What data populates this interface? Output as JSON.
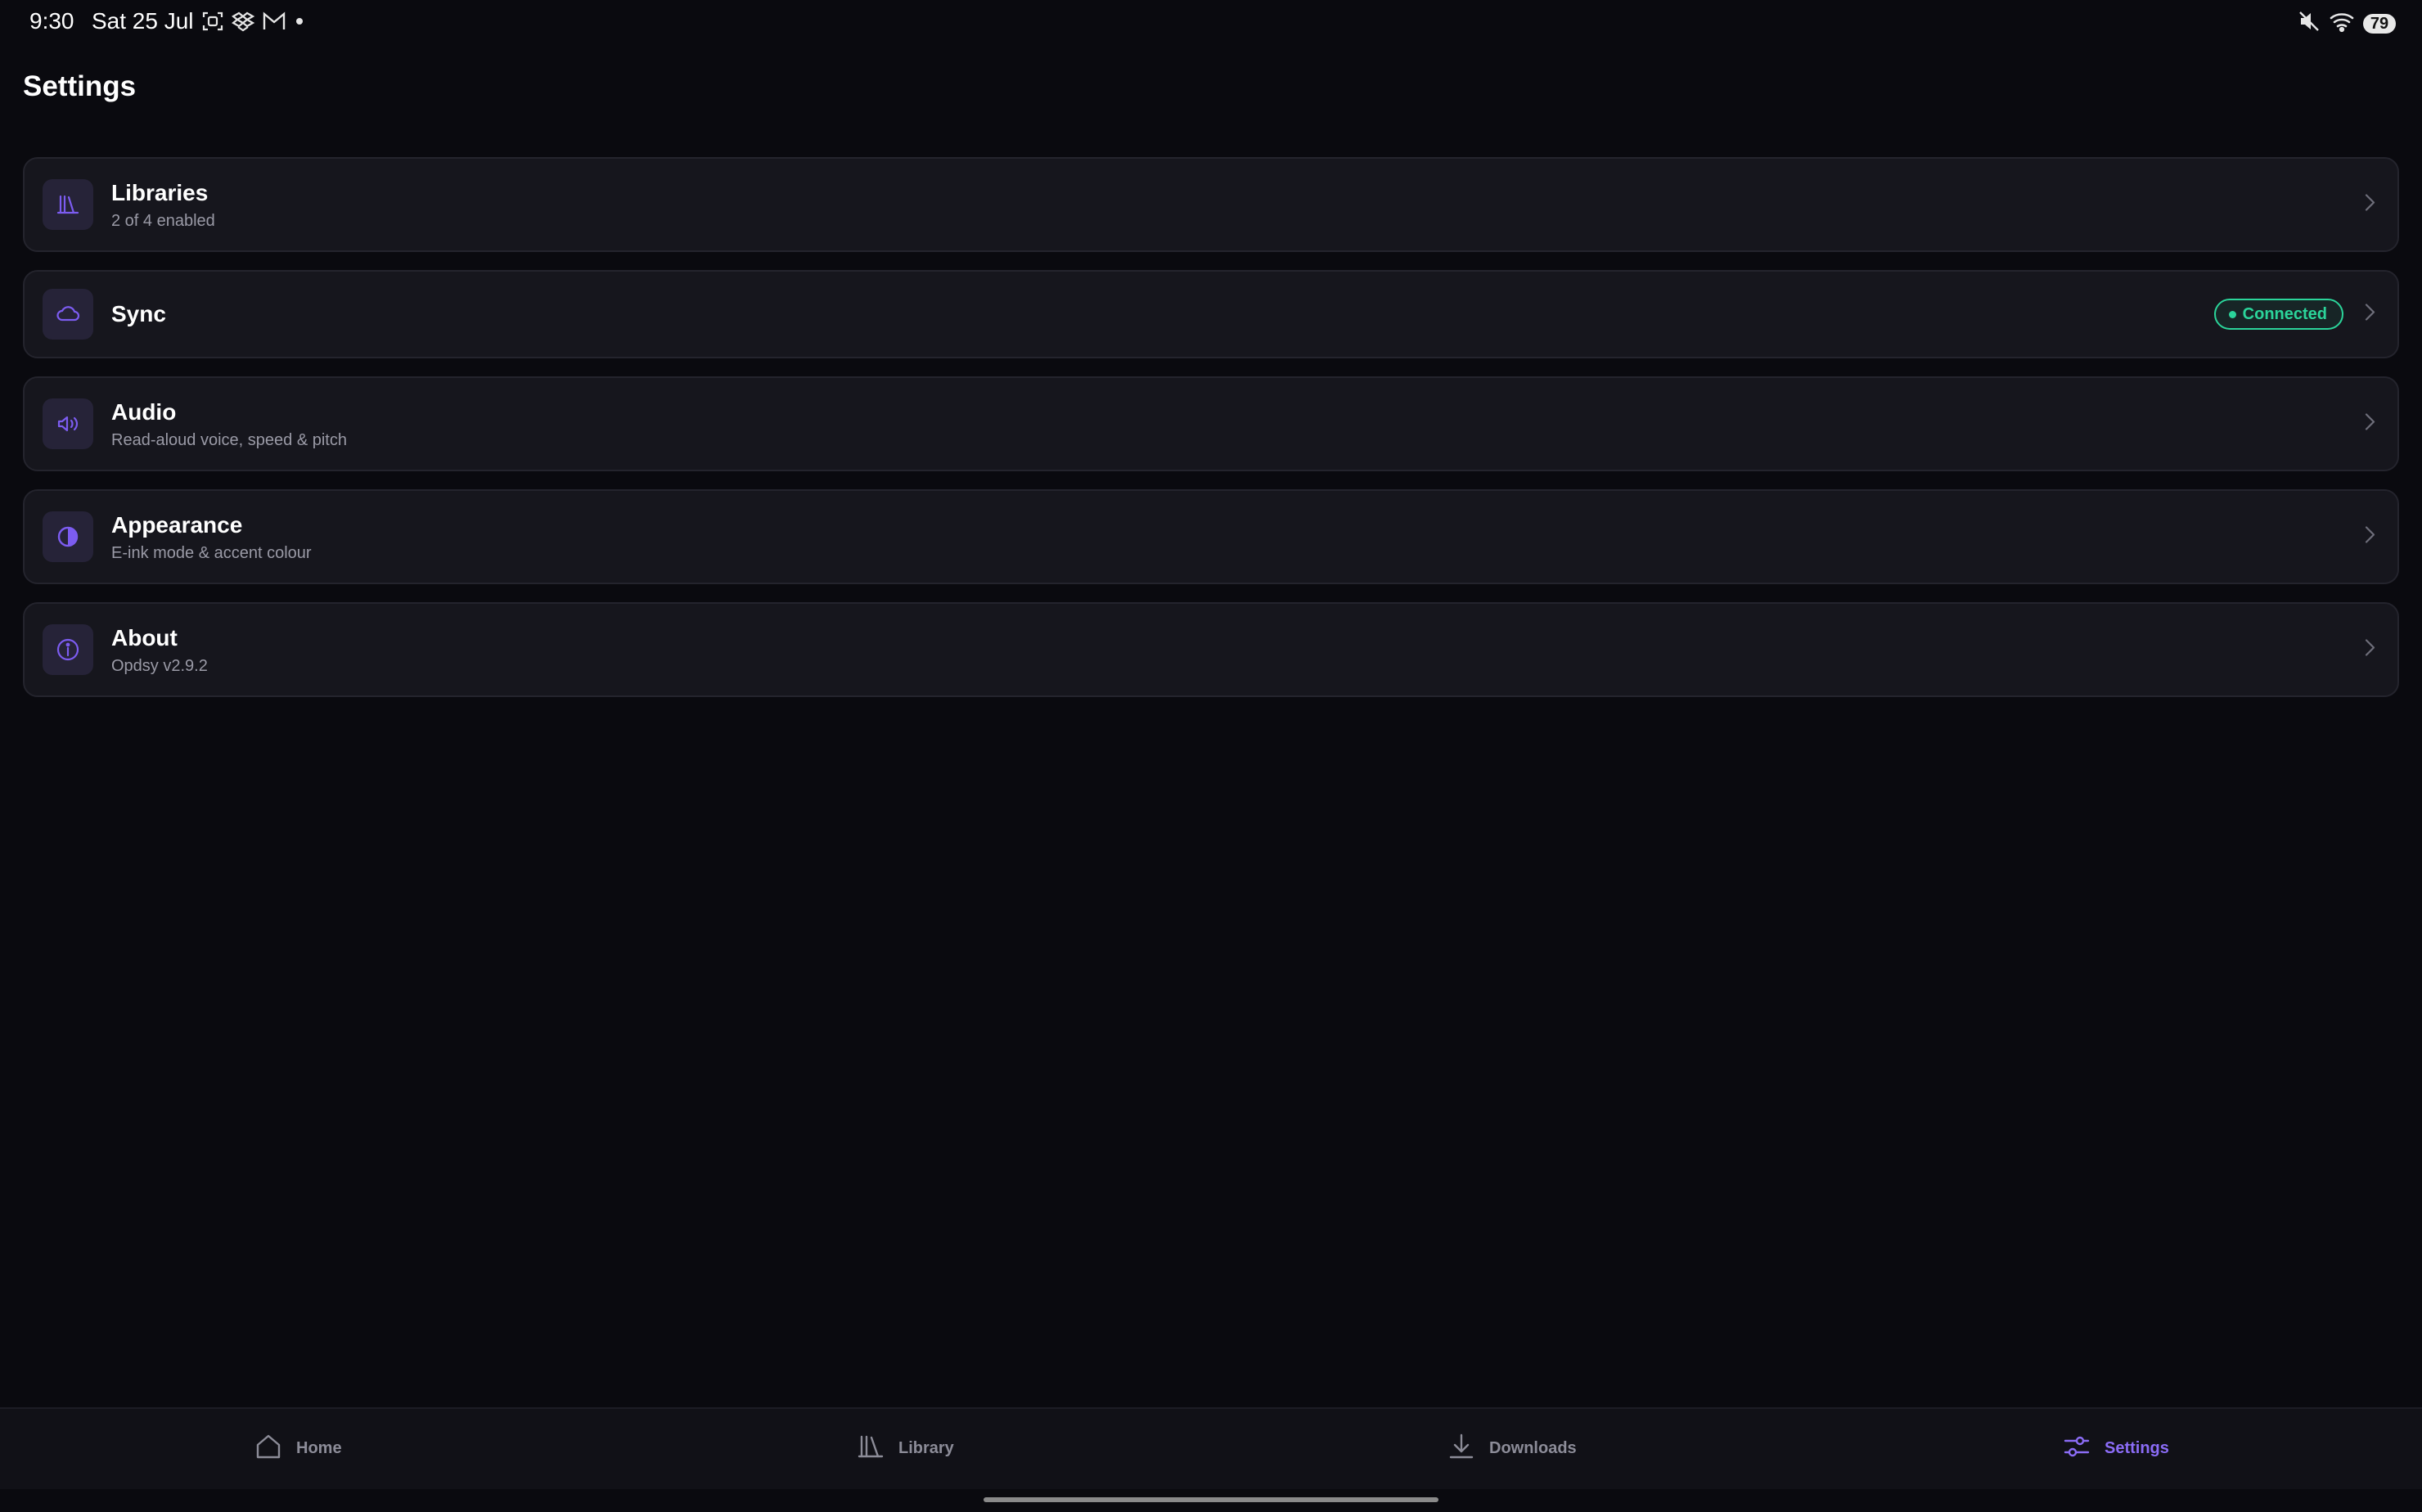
{
  "status_bar": {
    "time": "9:30",
    "date": "Sat 25 Jul",
    "left_icons": [
      "screenshot-icon",
      "dropbox-icon",
      "gmail-icon",
      "dot-icon"
    ],
    "right_icons": [
      "mute-icon",
      "wifi-icon"
    ],
    "battery": "79"
  },
  "page": {
    "title": "Settings"
  },
  "settings": {
    "items": [
      {
        "icon": "libraries-icon",
        "title": "Libraries",
        "subtitle": "2 of 4 enabled"
      },
      {
        "icon": "cloud-icon",
        "title": "Sync",
        "badge": "Connected"
      },
      {
        "icon": "speaker-icon",
        "title": "Audio",
        "subtitle": "Read-aloud voice, speed & pitch"
      },
      {
        "icon": "contrast-icon",
        "title": "Appearance",
        "subtitle": "E-ink mode & accent colour"
      },
      {
        "icon": "info-icon",
        "title": "About",
        "subtitle": "Opdsy v2.9.2"
      }
    ]
  },
  "bottom_nav": {
    "items": [
      {
        "icon": "home-icon",
        "label": "Home",
        "active": false
      },
      {
        "icon": "library-icon",
        "label": "Library",
        "active": false
      },
      {
        "icon": "download-icon",
        "label": "Downloads",
        "active": false
      },
      {
        "icon": "sliders-icon",
        "label": "Settings",
        "active": true
      }
    ]
  },
  "colors": {
    "background": "#0a0a0f",
    "card": "#16161d",
    "accent": "#8b6cf6",
    "success": "#2bd49a",
    "muted_text": "#9a9aa6"
  }
}
